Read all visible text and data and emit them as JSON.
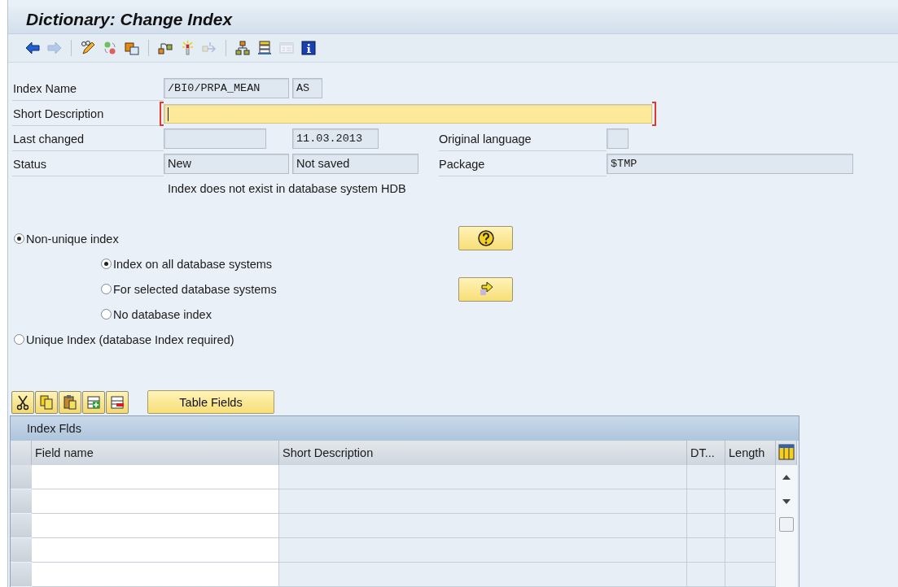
{
  "window": {
    "title": "Dictionary: Change Index"
  },
  "form": {
    "index_name": {
      "label": "Index Name",
      "value": "/BI0/PRPA_MEAN",
      "suffix": "AS"
    },
    "short_description": {
      "label": "Short Description",
      "focused": true
    },
    "last_changed": {
      "label": "Last changed",
      "date": "11.03.2013"
    },
    "original_language": {
      "label": "Original language"
    },
    "status": {
      "label": "Status",
      "value": "New",
      "save_state": "Not saved"
    },
    "package": {
      "label": "Package",
      "value": "$TMP"
    },
    "message": "Index does not exist in database system HDB"
  },
  "index_type": [
    {
      "label": "Non-unique index",
      "selected": true,
      "children": [
        {
          "label": "Index on all database systems",
          "selected": true
        },
        {
          "label": "For selected database systems",
          "selected": false
        },
        {
          "label": "No database index",
          "selected": false
        }
      ]
    },
    {
      "label": "Unique Index (database Index required)",
      "selected": false
    }
  ],
  "table_fields_button": "Table Fields",
  "table": {
    "title": "Index Flds",
    "columns": [
      "Field name",
      "Short Description",
      "DT...",
      "Length"
    ]
  }
}
